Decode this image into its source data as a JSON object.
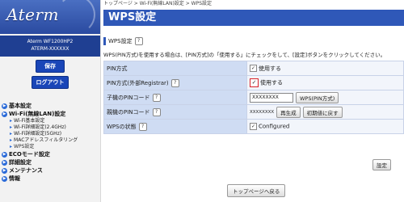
{
  "sidebar": {
    "logo": "Aterm",
    "model": "Aterm  WF1200HP2",
    "device_id": "ATERM-XXXXXX",
    "save_label": "保存",
    "logout_label": "ログアウト",
    "nav": [
      {
        "label": "基本設定"
      },
      {
        "label": "Wi-Fi(無線LAN)設定",
        "children": [
          "Wi-Fi基本設定",
          "Wi-Fi詳細設定(2.4GHz)",
          "Wi-Fi詳細設定(5GHz)",
          "MACアドレスフィルタリング",
          "WPS設定"
        ]
      },
      {
        "label": "ECOモード設定"
      },
      {
        "label": "詳細設定"
      },
      {
        "label": "メンテナンス"
      },
      {
        "label": "情報"
      }
    ]
  },
  "breadcrumb": [
    "トップページ",
    "Wi-Fi(無線LAN)設定",
    "WPS設定"
  ],
  "breadcrumb_sep": " > ",
  "page_title": "WPS設定",
  "section_title": "WPS設定",
  "help_glyph": "?",
  "description": "WPS(PIN方式)を使用する場合は、[PIN方式]の「使用する」にチェックをして、[設定]ボタンをクリックしてください。",
  "rows": {
    "pin_method": {
      "label": "PIN方式",
      "value": "使用する",
      "checked": true
    },
    "pin_external": {
      "label": "PIN方式(外部Registrar)",
      "value": "使用する",
      "checked": true
    },
    "child_pin": {
      "label": "子機のPINコード",
      "value": "XXXXXXXX",
      "button": "WPS(PIN方式)"
    },
    "parent_pin": {
      "label": "親機のPINコード",
      "value": "XXXXXXXX",
      "regen_button": "再生成",
      "reset_button": "初期値に戻す"
    },
    "wps_state": {
      "label": "WPSの状態",
      "value": "Configured",
      "checked": true
    }
  },
  "set_button": "設定",
  "top_button": "トップページへ戻る",
  "check_mark": "✓",
  "colors": {
    "title_bar": "#2f58b8",
    "accent_red": "#d8232a",
    "label_bg": "#cfdcf3"
  }
}
